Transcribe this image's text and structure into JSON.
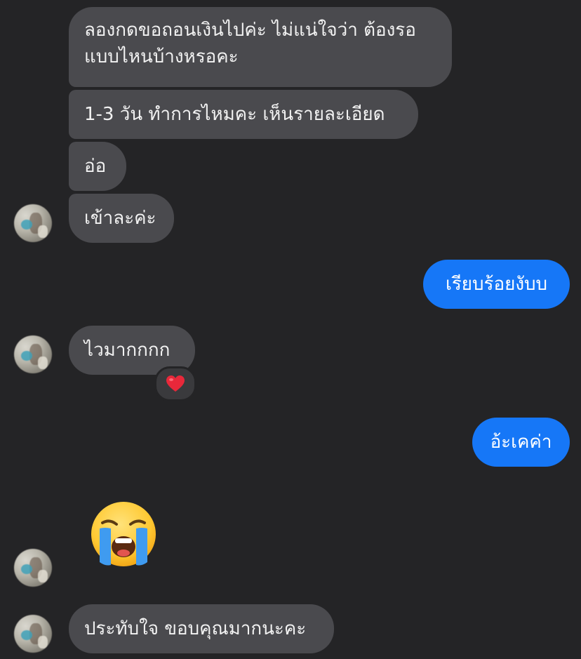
{
  "messages": {
    "m1_line1": "ลองกดขอถอนเงินไปค่ะ ไม่แน่ใจว่า ต้องรอ",
    "m1_line2": "แบบไหนบ้างหรอคะ",
    "m2": "1-3 วัน ทำการไหมคะ เห็นรายละเอียด",
    "m3": "อ่อ",
    "m4": "เข้าละค่ะ",
    "m5": "เรียบร้อยงับบ",
    "m6": "ไวมากกกก",
    "m7": "อ้ะเคค่า",
    "m9": "ประทับใจ ขอบคุณมากนะคะ"
  },
  "reaction": {
    "icon": "heart-icon",
    "color": "#e8283a"
  },
  "sticker": {
    "icon": "loudly-crying-face-icon"
  },
  "colors": {
    "background": "#242426",
    "incoming_bubble": "#4a4a4e",
    "outgoing_bubble": "#1677f7"
  }
}
